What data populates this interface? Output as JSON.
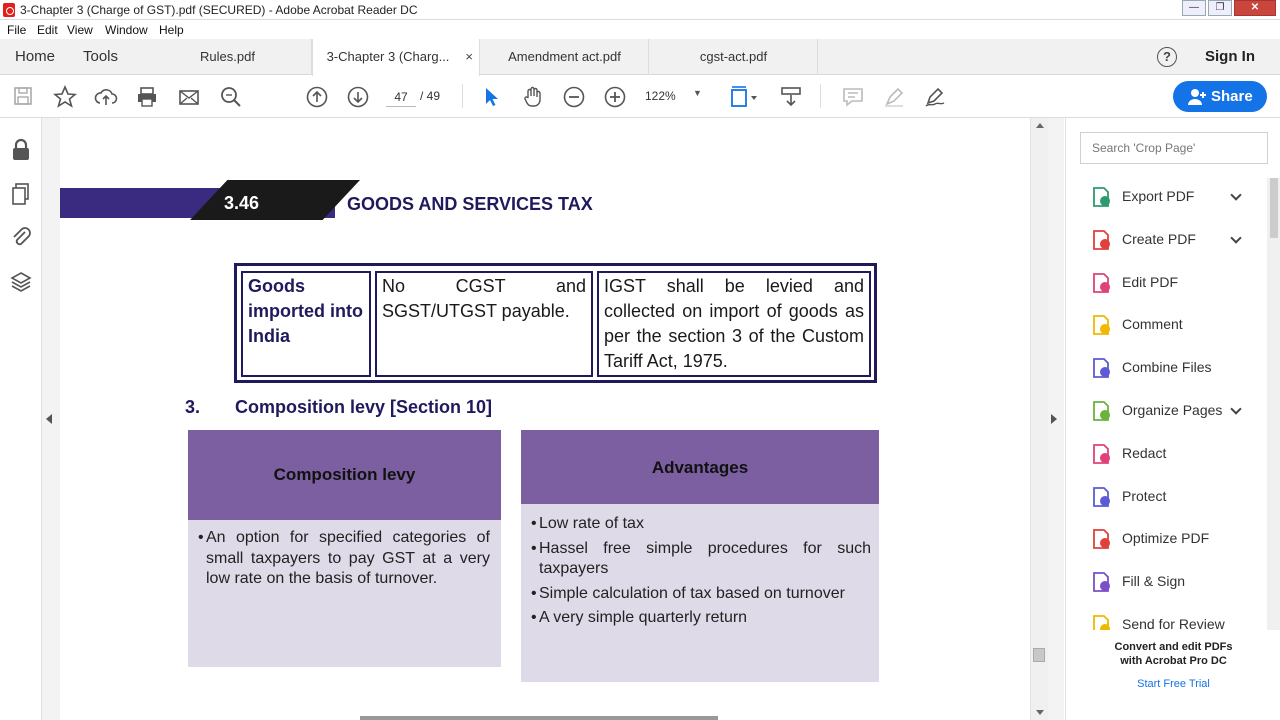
{
  "window": {
    "title": "3-Chapter 3 (Charge of GST).pdf (SECURED) - Adobe Acrobat Reader DC"
  },
  "menu": [
    "File",
    "Edit",
    "View",
    "Window",
    "Help"
  ],
  "tabs": {
    "home": "Home",
    "tools": "Tools",
    "docs": [
      {
        "label": "Rules.pdf"
      },
      {
        "label": "3-Chapter 3 (Charg...",
        "active": true,
        "close": "×"
      },
      {
        "label": "Amendment act.pdf"
      },
      {
        "label": "cgst-act.pdf"
      }
    ],
    "help": "?",
    "sign_in": "Sign In"
  },
  "toolbar": {
    "page_current": "47",
    "page_total": "/ 49",
    "zoom": "122%",
    "share": "Share"
  },
  "document": {
    "chapter_number": "3.46",
    "chapter_title": "GOODS AND SERVICES TAX",
    "table_row": {
      "col1": "Goods imported into India",
      "col2": "No CGST and SGST/UTGST payable.",
      "col3": "IGST shall be levied and collected on import of goods as per the section 3 of the Custom Tariff Act, 1975."
    },
    "section_number": "3.",
    "section_title": "Composition levy [Section 10]",
    "box_left": {
      "heading": "Composition levy",
      "points": [
        "An option for specified categories of small taxpayers to pay GST at a very low rate on the basis of turnover."
      ]
    },
    "box_right": {
      "heading": "Advantages",
      "points": [
        "Low rate of tax",
        "Hassel free simple procedures  for such taxpayers",
        "Simple calculation of  tax based on turnover",
        "A very simple quarterly return"
      ]
    }
  },
  "right_panel": {
    "search_placeholder": "Search 'Crop Page'",
    "tools": [
      {
        "label": "Export PDF",
        "icon": "export-pdf-icon",
        "color": "#2d9b6f",
        "expand": true
      },
      {
        "label": "Create PDF",
        "icon": "create-pdf-icon",
        "color": "#e0413b",
        "expand": true
      },
      {
        "label": "Edit PDF",
        "icon": "edit-pdf-icon",
        "color": "#e0417a",
        "expand": false
      },
      {
        "label": "Comment",
        "icon": "comment-icon",
        "color": "#f0b800",
        "expand": false
      },
      {
        "label": "Combine Files",
        "icon": "combine-files-icon",
        "color": "#5b5bd6",
        "expand": false
      },
      {
        "label": "Organize Pages",
        "icon": "organize-pages-icon",
        "color": "#6bb33a",
        "expand": true
      },
      {
        "label": "Redact",
        "icon": "redact-icon",
        "color": "#e0417a",
        "expand": false
      },
      {
        "label": "Protect",
        "icon": "protect-icon",
        "color": "#5b5bd6",
        "expand": false
      },
      {
        "label": "Optimize PDF",
        "icon": "optimize-pdf-icon",
        "color": "#e0413b",
        "expand": false
      },
      {
        "label": "Fill & Sign",
        "icon": "fill-sign-icon",
        "color": "#7b4fc8",
        "expand": false
      },
      {
        "label": "Send for Review",
        "icon": "send-for-review-icon",
        "color": "#f0b800",
        "expand": false
      }
    ],
    "promo": {
      "line1": "Convert and edit PDFs",
      "line2": "with Acrobat Pro DC",
      "trial": "Start Free Trial"
    }
  }
}
